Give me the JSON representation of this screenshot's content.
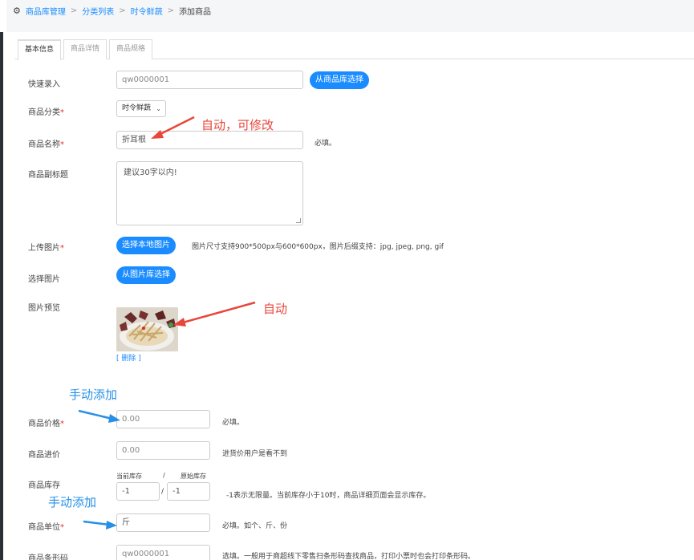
{
  "breadcrumb": {
    "items": [
      "商品库管理",
      "分类列表",
      "时令鲜蔬"
    ],
    "current": "添加商品",
    "separator": ">"
  },
  "tabs": [
    "基本信息",
    "商品详情",
    "商品规格"
  ],
  "form": {
    "quick_entry": {
      "label": "快速录入",
      "value": "qw0000001",
      "button": "从商品库选择"
    },
    "category": {
      "label": "商品分类",
      "selected": "时令鲜蔬"
    },
    "name": {
      "label": "商品名称",
      "value": "折耳根",
      "note": "必填。"
    },
    "subtitle": {
      "label": "商品副标题",
      "placeholder": "建议30字以内!"
    },
    "upload": {
      "label": "上传图片",
      "button": "选择本地图片",
      "note": "图片尺寸支持900*500px与600*600px，图片后缀支持：jpg, jpeg, png, gif"
    },
    "choose_image": {
      "label": "选择图片",
      "button": "从图片库选择"
    },
    "preview": {
      "label": "图片预览",
      "delete": "[ 删除 ]"
    },
    "price": {
      "label": "商品价格",
      "value": "0.00",
      "note": "必填。"
    },
    "cost": {
      "label": "商品进价",
      "value": "0.00",
      "note": "进货价用户是看不到"
    },
    "stock": {
      "label": "商品库存",
      "current_label": "当前库存",
      "slash": "/",
      "original_label": "原始库存",
      "current_value": "-1",
      "original_value": "-1",
      "note": "-1表示无限量。当前库存小于10时，商品详细页面会显示库存。"
    },
    "unit": {
      "label": "商品单位",
      "value": "斤",
      "note": "必填。如个、斤、份"
    },
    "barcode": {
      "label": "商品条形码",
      "value": "qw0000001",
      "note": "选填。一般用于商超线下零售扫条形码查找商品，打印小票时也会打印条形码。"
    }
  },
  "required_mark": "*",
  "annotations": {
    "auto_editable": "自动，可修改",
    "auto": "自动",
    "manual_1": "手动添加",
    "manual_2": "手动添加"
  },
  "colors": {
    "accent": "#1a8cff",
    "required": "#e03030",
    "annotation_red": "#e8463a",
    "annotation_blue": "#2790e6"
  }
}
